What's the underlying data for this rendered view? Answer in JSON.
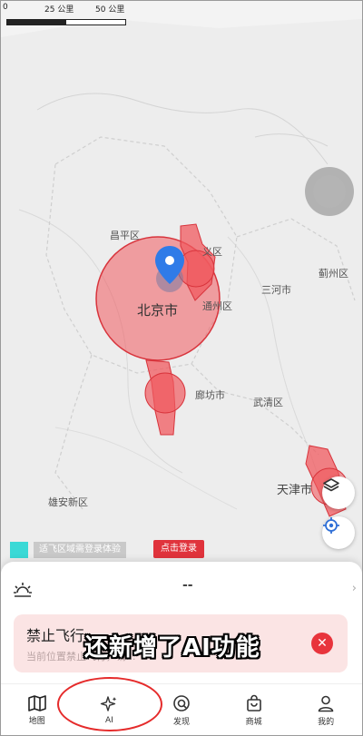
{
  "map": {
    "scale": {
      "zero": "0",
      "mid": "25 公里",
      "max": "50 公里"
    },
    "places": {
      "changping": "昌平区",
      "shunyi": "义区",
      "beijing": "北京市",
      "tongzhou": "通州区",
      "sanhe": "三河市",
      "jizhou": "蓟州区",
      "langfang": "廊坊市",
      "wuqing": "武清区",
      "tianjin": "天津市",
      "xiongan": "雄安新区"
    },
    "trial_text": "适飞区域需登录体验",
    "login_label": "点击登录",
    "zone_color": "#f05a5f"
  },
  "panel": {
    "weather_value": "--",
    "alert_title": "禁止飞行",
    "alert_subtitle": "当前位置禁止飞行，请..."
  },
  "caption": "还新增了AI功能",
  "tabs": [
    {
      "label": "地图",
      "icon": "map-icon"
    },
    {
      "label": "AI",
      "icon": "sparkle-icon"
    },
    {
      "label": "发现",
      "icon": "discover-icon"
    },
    {
      "label": "商城",
      "icon": "bag-icon"
    },
    {
      "label": "我的",
      "icon": "person-icon"
    }
  ],
  "colors": {
    "accent": "#e0333c",
    "highlight_ring": "#e52b2b"
  }
}
